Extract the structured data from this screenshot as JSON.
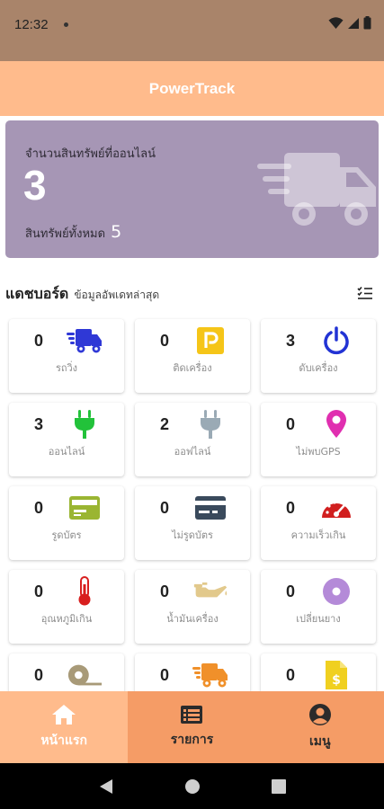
{
  "status_bar": {
    "time": "12:32"
  },
  "app": {
    "title": "PowerTrack"
  },
  "summary": {
    "online_label": "จำนวนสินทรัพย์ที่ออนไลน์",
    "online_count": "3",
    "total_label": "สินทรัพย์ทั้งหมด",
    "total_count": "5"
  },
  "dashboard": {
    "title": "แดชบอร์ด",
    "subtitle": "ข้อมูลอัพเดทล่าสุด",
    "tiles": [
      {
        "count": "0",
        "label": "รถวิ่ง",
        "icon": "truck-moving-icon",
        "color": "#2f38d6"
      },
      {
        "count": "0",
        "label": "ติดเครื่อง",
        "icon": "parking-icon",
        "color": "#f5c518"
      },
      {
        "count": "3",
        "label": "ดับเครื่อง",
        "icon": "power-icon",
        "color": "#2233d4"
      },
      {
        "count": "3",
        "label": "ออนไลน์",
        "icon": "plug-online-icon",
        "color": "#22c23a"
      },
      {
        "count": "2",
        "label": "ออฟไลน์",
        "icon": "plug-offline-icon",
        "color": "#9aaab5"
      },
      {
        "count": "0",
        "label": "ไม่พบGPS",
        "icon": "location-pin-icon",
        "color": "#e02fb0"
      },
      {
        "count": "0",
        "label": "รูดบัตร",
        "icon": "card-swipe-icon",
        "color": "#9ab532"
      },
      {
        "count": "0",
        "label": "ไม่รูดบัตร",
        "icon": "card-no-swipe-icon",
        "color": "#3a4a5c"
      },
      {
        "count": "0",
        "label": "ความเร็วเกิน",
        "icon": "speedometer-icon",
        "color": "#d11f1f"
      },
      {
        "count": "0",
        "label": "อุณหภูมิเกิน",
        "icon": "thermometer-icon",
        "color": "#d81f1f"
      },
      {
        "count": "0",
        "label": "น้ำมันเครื่อง",
        "icon": "oil-can-icon",
        "color": "#e2c98c"
      },
      {
        "count": "0",
        "label": "เปลี่ยนยาง",
        "icon": "tire-icon",
        "color": "#b48ad8"
      },
      {
        "count": "0",
        "label": "",
        "icon": "tape-icon",
        "color": "#a89a78"
      },
      {
        "count": "0",
        "label": "",
        "icon": "truck-fast-icon",
        "color": "#f0902a"
      },
      {
        "count": "0",
        "label": "",
        "icon": "invoice-dollar-icon",
        "color": "#f0d020"
      }
    ]
  },
  "nav": {
    "home": "หน้าแรก",
    "list": "รายการ",
    "menu": "เมนู"
  }
}
